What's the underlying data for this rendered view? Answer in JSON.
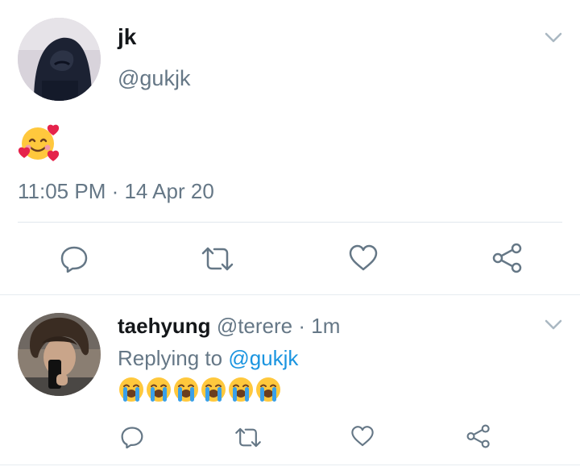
{
  "main_tweet": {
    "author_name": "jk",
    "author_handle": "@gukjk",
    "content_emoji": "smiling-face-with-hearts",
    "timestamp": "11:05 PM · 14 Apr 20",
    "avatar_icon": "hooded-person-photo",
    "menu_icon": "chevron-down-icon",
    "actions": [
      "reply-icon",
      "retweet-icon",
      "like-icon",
      "share-icon"
    ]
  },
  "reply_tweet": {
    "author_name": "taehyung",
    "author_handle": "@terere",
    "separator": "·",
    "time_ago": "1m",
    "replying_to_label": "Replying to",
    "replying_to_handle": "@gukjk",
    "content_emoji": "loudly-crying-face",
    "content_emoji_count": 6,
    "avatar_icon": "selfie-photo",
    "menu_icon": "chevron-down-icon",
    "actions": [
      "reply-icon",
      "retweet-icon",
      "like-icon",
      "share-icon"
    ]
  },
  "colors": {
    "text": "#14171a",
    "muted": "#657786",
    "link": "#1b95e0",
    "divider": "#e1e8ed"
  }
}
